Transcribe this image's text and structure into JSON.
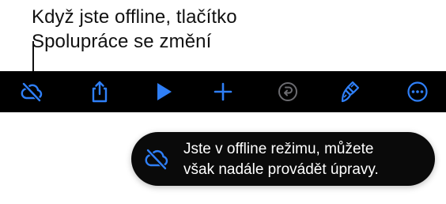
{
  "callout": {
    "line1": "Když jste offline, tlačítko",
    "line2": "Spolupráce se změní"
  },
  "toolbar": {
    "buttons": [
      {
        "name": "collaboration-offline",
        "icon": "cloud-slash-icon"
      },
      {
        "name": "share",
        "icon": "share-icon"
      },
      {
        "name": "play",
        "icon": "play-icon"
      },
      {
        "name": "add",
        "icon": "plus-icon"
      },
      {
        "name": "undo",
        "icon": "undo-icon",
        "disabled": true
      },
      {
        "name": "format",
        "icon": "paintbrush-icon"
      },
      {
        "name": "more",
        "icon": "ellipsis-circle-icon"
      }
    ]
  },
  "banner": {
    "icon": "cloud-slash-icon",
    "line1": "Jste v offline režimu, můžete",
    "line2": "však nadále provádět úpravy."
  },
  "colors": {
    "accent": "#2f7ff7",
    "disabled": "#6b6b70",
    "toolbar_bg": "#000000",
    "banner_bg": "#0a0a0a",
    "banner_text": "#ffffff"
  }
}
